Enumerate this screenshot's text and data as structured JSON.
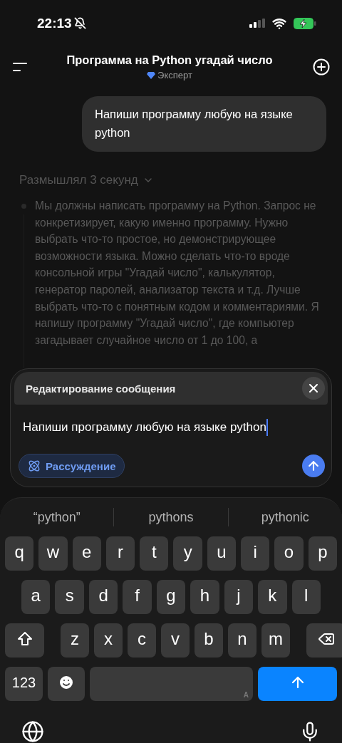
{
  "status_bar": {
    "time": "22:13",
    "silent": true
  },
  "header": {
    "title": "Программа на Python угадай число",
    "model": "Эксперт"
  },
  "messages": [
    {
      "kind": "user",
      "text": "Напиши программу любую на языке python"
    }
  ],
  "reasoning": {
    "label": "Размышлял 3 секунд",
    "expanded": true,
    "text": "Мы должны написать программу на Python. Запрос не конкретизирует, какую именно программу. Нужно выбрать что-то простое, но демонстрирующее возможности языка. Можно сделать что-то вроде консольной игры \"Угадай число\", калькулятор, генератор паролей, анализатор текста и т.д. Лучше выбрать что-то с понятным кодом и комментариями. Я напишу программу \"Угадай число\", где компьютер загадывает случайное число от 1 до 100, а"
  },
  "edit_panel": {
    "title": "Редактирование сообщения",
    "value": "Напиши программу любую на языке python",
    "reasoning_toggle": {
      "label": "Рассуждение",
      "on": true
    }
  },
  "keyboard": {
    "suggestions": [
      "“python”",
      "pythons",
      "pythonic"
    ],
    "rows": [
      [
        "q",
        "w",
        "e",
        "r",
        "t",
        "y",
        "u",
        "i",
        "o",
        "p"
      ],
      [
        "a",
        "s",
        "d",
        "f",
        "g",
        "h",
        "j",
        "k",
        "l"
      ],
      [
        "z",
        "x",
        "c",
        "v",
        "b",
        "n",
        "m"
      ]
    ],
    "numbers_key": "123",
    "space_mark": "A"
  }
}
